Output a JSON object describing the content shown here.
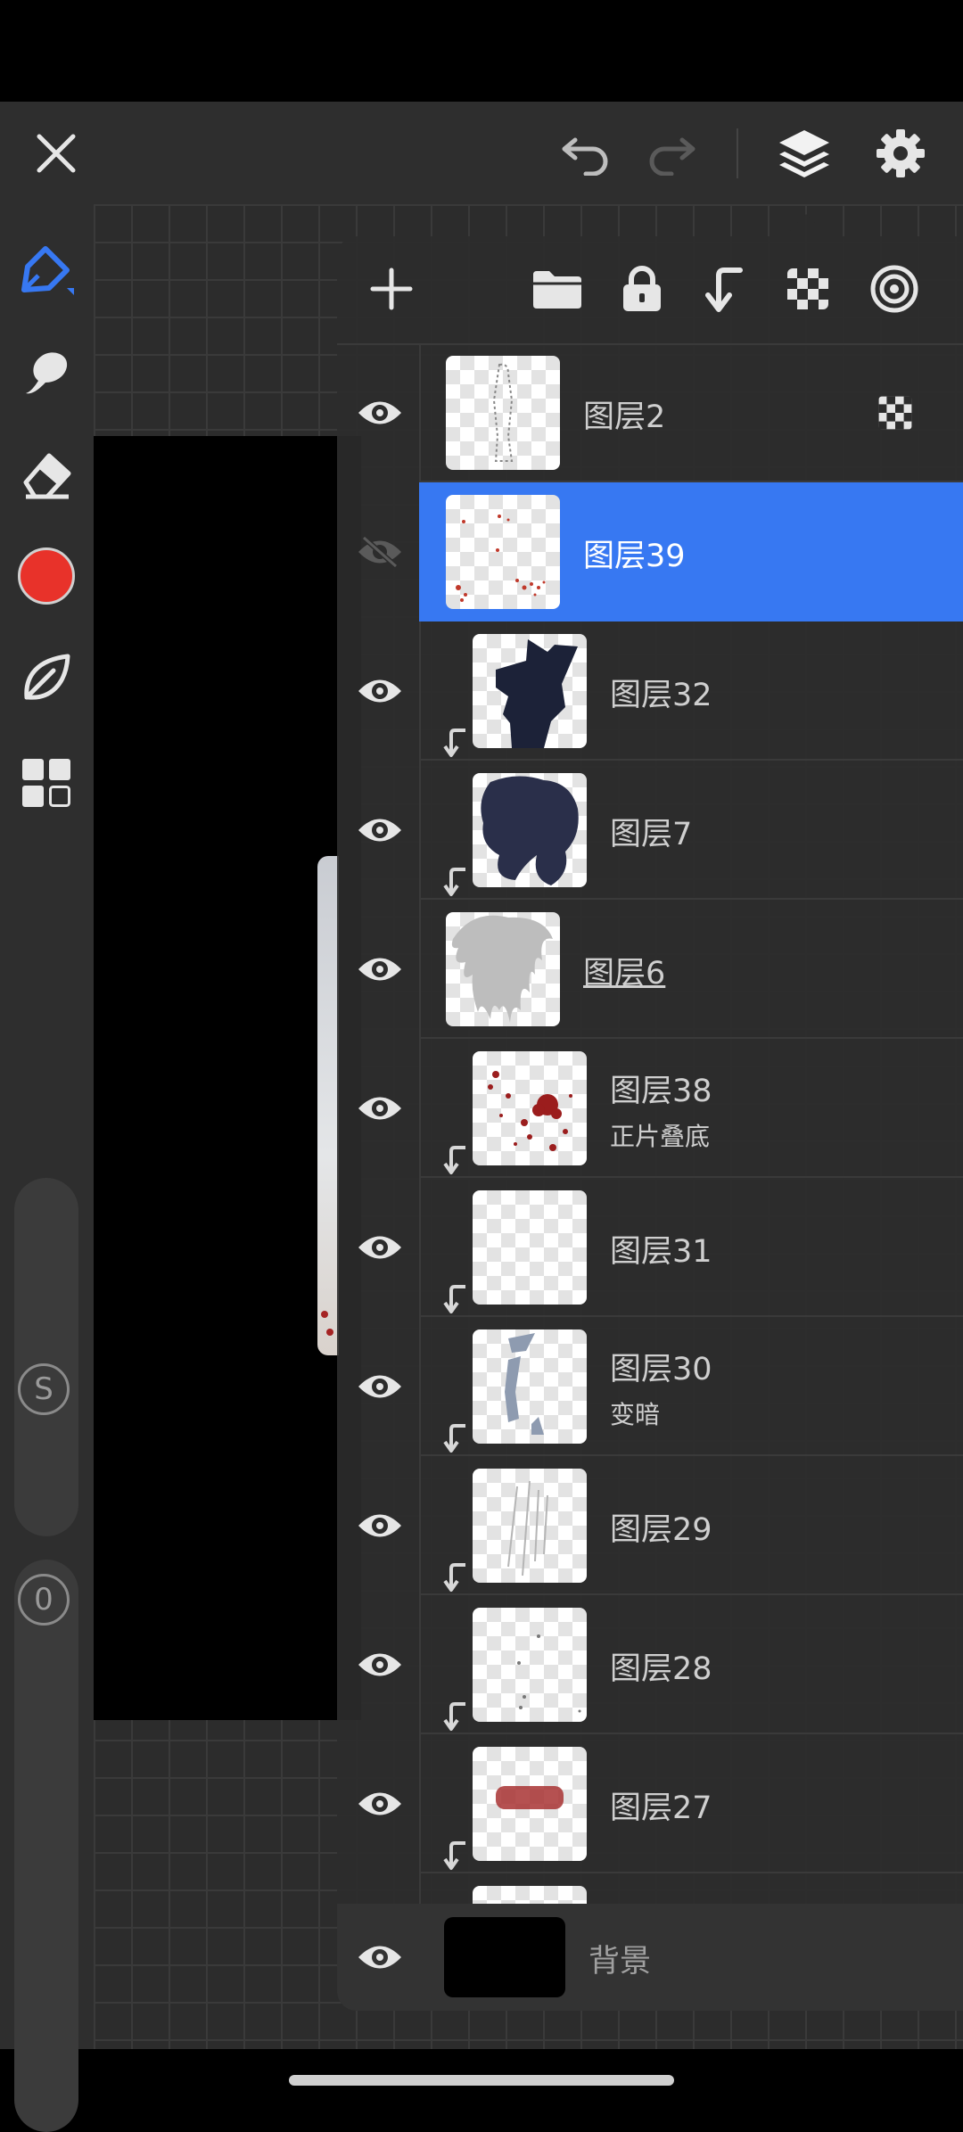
{
  "app": {
    "accent_color": "#3778f2",
    "brush_color": "#e8322a"
  },
  "top_bar": {
    "close_icon": "close-icon",
    "undo_icon": "undo-icon",
    "redo_icon": "redo-icon",
    "layers_icon": "layers-icon",
    "settings_icon": "gear-icon"
  },
  "left_toolbar": {
    "tools": [
      "brush-icon",
      "smudge-icon",
      "eraser-icon",
      "color-swatch",
      "leaf-icon",
      "grid-icon"
    ],
    "size_badge": "S",
    "opacity_badge": "0"
  },
  "layer_toolbar": {
    "icons": [
      "add-icon",
      "folder-icon",
      "lock-icon",
      "clip-icon",
      "checker-icon",
      "target-icon"
    ]
  },
  "layers": [
    {
      "name": "图层2",
      "mode": "",
      "visible": true,
      "selected": false,
      "clipped": false,
      "underline": false,
      "alpha_lock": true
    },
    {
      "name": "图层39",
      "mode": "",
      "visible": false,
      "selected": true,
      "clipped": false,
      "underline": false,
      "alpha_lock": false
    },
    {
      "name": "图层32",
      "mode": "",
      "visible": true,
      "selected": false,
      "clipped": true,
      "underline": false,
      "alpha_lock": false
    },
    {
      "name": "图层7",
      "mode": "",
      "visible": true,
      "selected": false,
      "clipped": true,
      "underline": false,
      "alpha_lock": false
    },
    {
      "name": "图层6",
      "mode": "",
      "visible": true,
      "selected": false,
      "clipped": false,
      "underline": true,
      "alpha_lock": false
    },
    {
      "name": "图层38",
      "mode": "正片叠底",
      "visible": true,
      "selected": false,
      "clipped": true,
      "underline": false,
      "alpha_lock": false
    },
    {
      "name": "图层31",
      "mode": "",
      "visible": true,
      "selected": false,
      "clipped": true,
      "underline": false,
      "alpha_lock": false
    },
    {
      "name": "图层30",
      "mode": "变暗",
      "visible": true,
      "selected": false,
      "clipped": true,
      "underline": false,
      "alpha_lock": false
    },
    {
      "name": "图层29",
      "mode": "",
      "visible": true,
      "selected": false,
      "clipped": true,
      "underline": false,
      "alpha_lock": false
    },
    {
      "name": "图层28",
      "mode": "",
      "visible": true,
      "selected": false,
      "clipped": true,
      "underline": false,
      "alpha_lock": false
    },
    {
      "name": "图层27",
      "mode": "",
      "visible": true,
      "selected": false,
      "clipped": true,
      "underline": false,
      "alpha_lock": false
    }
  ],
  "background_layer": {
    "name": "背景",
    "visible": true,
    "color": "#000000"
  }
}
